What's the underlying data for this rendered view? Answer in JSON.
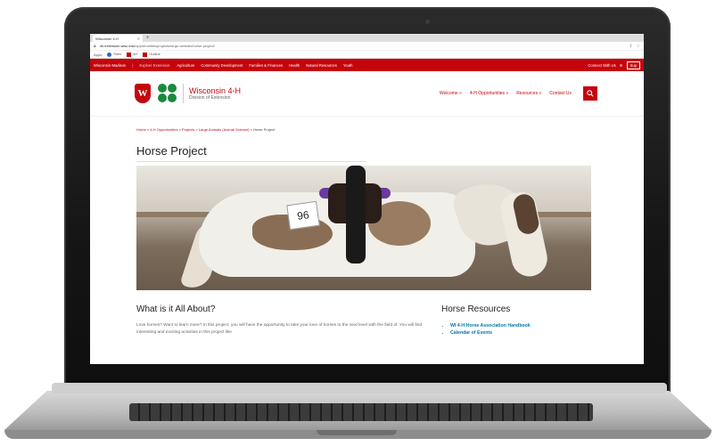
{
  "browser": {
    "tab_title": "Wisconsin 4-H",
    "new_tab_symbol": "+",
    "url_domain": "4h.extension.wisc.edu",
    "url_path": "/opportunities/projects/large-animals/horse-project/",
    "bookmarks": [
      "Apps",
      "Sites",
      "4H",
      "Outline"
    ]
  },
  "topbar": {
    "left_label": "Wisconsin-Madison",
    "explore_label": "Explore Extension:",
    "links": [
      "Agriculture",
      "Community Development",
      "Families & Finances",
      "Health",
      "Natural Resources",
      "Youth"
    ],
    "connect_label": "Connect With Us",
    "support_label": "Sup"
  },
  "header": {
    "crest_letter": "W",
    "brand_title": "Wisconsin 4-H",
    "brand_subtitle": "Division of Extension",
    "nav": [
      "Welcome »",
      "4-H Opportunities »",
      "Resources »",
      "Contact Us"
    ]
  },
  "breadcrumb": {
    "trail": "Home » 4-H Opportunities » Projects » Large Animals (Animal Science) » ",
    "current": "Horse Project"
  },
  "page": {
    "title": "Horse Project",
    "hero_tag_number": "96",
    "section_title": "What is it All About?",
    "intro_text": "Love horses? Want to learn more? In this project, you will have the opportunity to take your love of horses to the next level with the field of. You will find interesting and exciting activities in this project like",
    "sidebar_title": "Horse Resources",
    "sidebar_links": [
      "WI 4-H Horse Association Handbook",
      "Calendar of Events"
    ]
  },
  "colors": {
    "uw_red": "#c5050c",
    "clover_green": "#1b8a3d",
    "link_blue": "#0479a8"
  }
}
